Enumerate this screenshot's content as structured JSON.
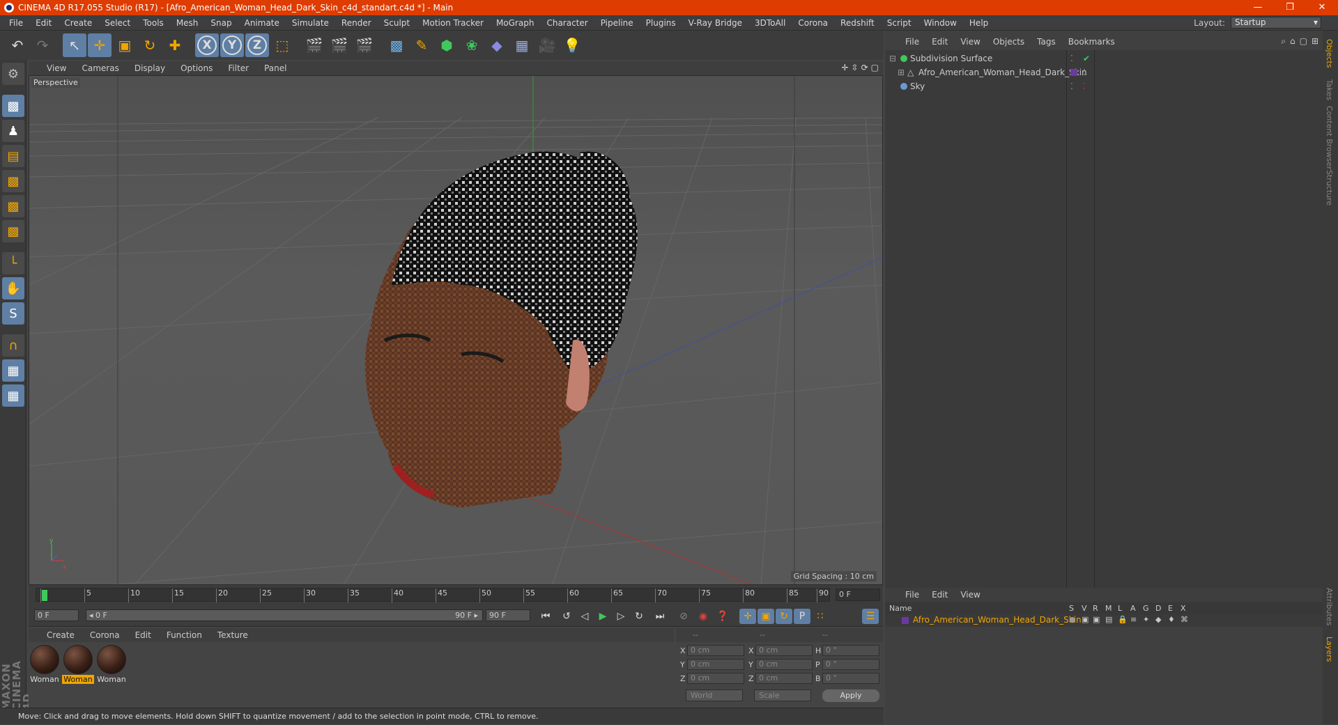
{
  "window": {
    "title": "CINEMA 4D R17.055 Studio (R17) - [Afro_American_Woman_Head_Dark_Skin_c4d_standart.c4d *] - Main",
    "minimize": "—",
    "restore": "❐",
    "close": "✕"
  },
  "menu": [
    "File",
    "Edit",
    "Create",
    "Select",
    "Tools",
    "Mesh",
    "Snap",
    "Animate",
    "Simulate",
    "Render",
    "Sculpt",
    "Motion Tracker",
    "MoGraph",
    "Character",
    "Pipeline",
    "Plugins",
    "V-Ray Bridge",
    "3DToAll",
    "Corona",
    "Redshift",
    "Script",
    "Window",
    "Help"
  ],
  "layout": {
    "label": "Layout:",
    "value": "Startup"
  },
  "viewport": {
    "menu": [
      "View",
      "Cameras",
      "Display",
      "Options",
      "Filter",
      "Panel"
    ],
    "label": "Perspective",
    "grid_spacing": "Grid Spacing : 10 cm"
  },
  "timeline": {
    "ticks": [
      "0",
      "5",
      "10",
      "15",
      "20",
      "25",
      "30",
      "35",
      "40",
      "45",
      "50",
      "55",
      "60",
      "65",
      "70",
      "75",
      "80",
      "85",
      "90"
    ],
    "end_frame": "0 F",
    "start_field": "0 F",
    "range_start": "◂ 0 F",
    "range_end": "90 F ▸",
    "end_field": "90 F"
  },
  "material_manager": {
    "menu": [
      "Create",
      "Corona",
      "Edit",
      "Function",
      "Texture"
    ],
    "materials": [
      {
        "name": "Woman",
        "selected": false
      },
      {
        "name": "Woman",
        "selected": true
      },
      {
        "name": "Woman",
        "selected": false
      }
    ]
  },
  "coordinates": {
    "header": [
      "--",
      "--",
      "--"
    ],
    "rows": [
      {
        "l1": "X",
        "v1": "0 cm",
        "l2": "X",
        "v2": "0 cm",
        "l3": "H",
        "v3": "0 °"
      },
      {
        "l1": "Y",
        "v1": "0 cm",
        "l2": "Y",
        "v2": "0 cm",
        "l3": "P",
        "v3": "0 °"
      },
      {
        "l1": "Z",
        "v1": "0 cm",
        "l2": "Z",
        "v2": "0 cm",
        "l3": "B",
        "v3": "0 °"
      }
    ],
    "world": "World",
    "scale": "Scale",
    "apply": "Apply"
  },
  "status": "Move: Click and drag to move elements. Hold down SHIFT to quantize movement / add to the selection in point mode, CTRL to remove.",
  "object_manager": {
    "menu": [
      "File",
      "Edit",
      "View",
      "Objects",
      "Tags",
      "Bookmarks"
    ],
    "objects": [
      {
        "name": "Subdivision Surface",
        "color": "#3fc85c"
      },
      {
        "name": "Afro_American_Woman_Head_Dark_Skin",
        "color": "#a0a0a0"
      },
      {
        "name": "Sky",
        "color": "#6a9ad0"
      }
    ]
  },
  "layer_manager": {
    "menu": [
      "File",
      "Edit",
      "View"
    ],
    "columns": [
      "Name",
      "S",
      "V",
      "R",
      "M",
      "L",
      "A",
      "G",
      "D",
      "E",
      "X"
    ],
    "layer": "Afro_American_Woman_Head_Dark_Skin"
  },
  "side_tabs": [
    "Objects",
    "Takes",
    "Content Browser",
    "Structure",
    "Attributes",
    "Layers"
  ],
  "branding": "MAXON CINEMA 4D",
  "colors": {
    "accent": "#de3c00",
    "selection": "#5f7fa5",
    "highlight": "#f0a500",
    "active_frame": "#3fc85c"
  }
}
